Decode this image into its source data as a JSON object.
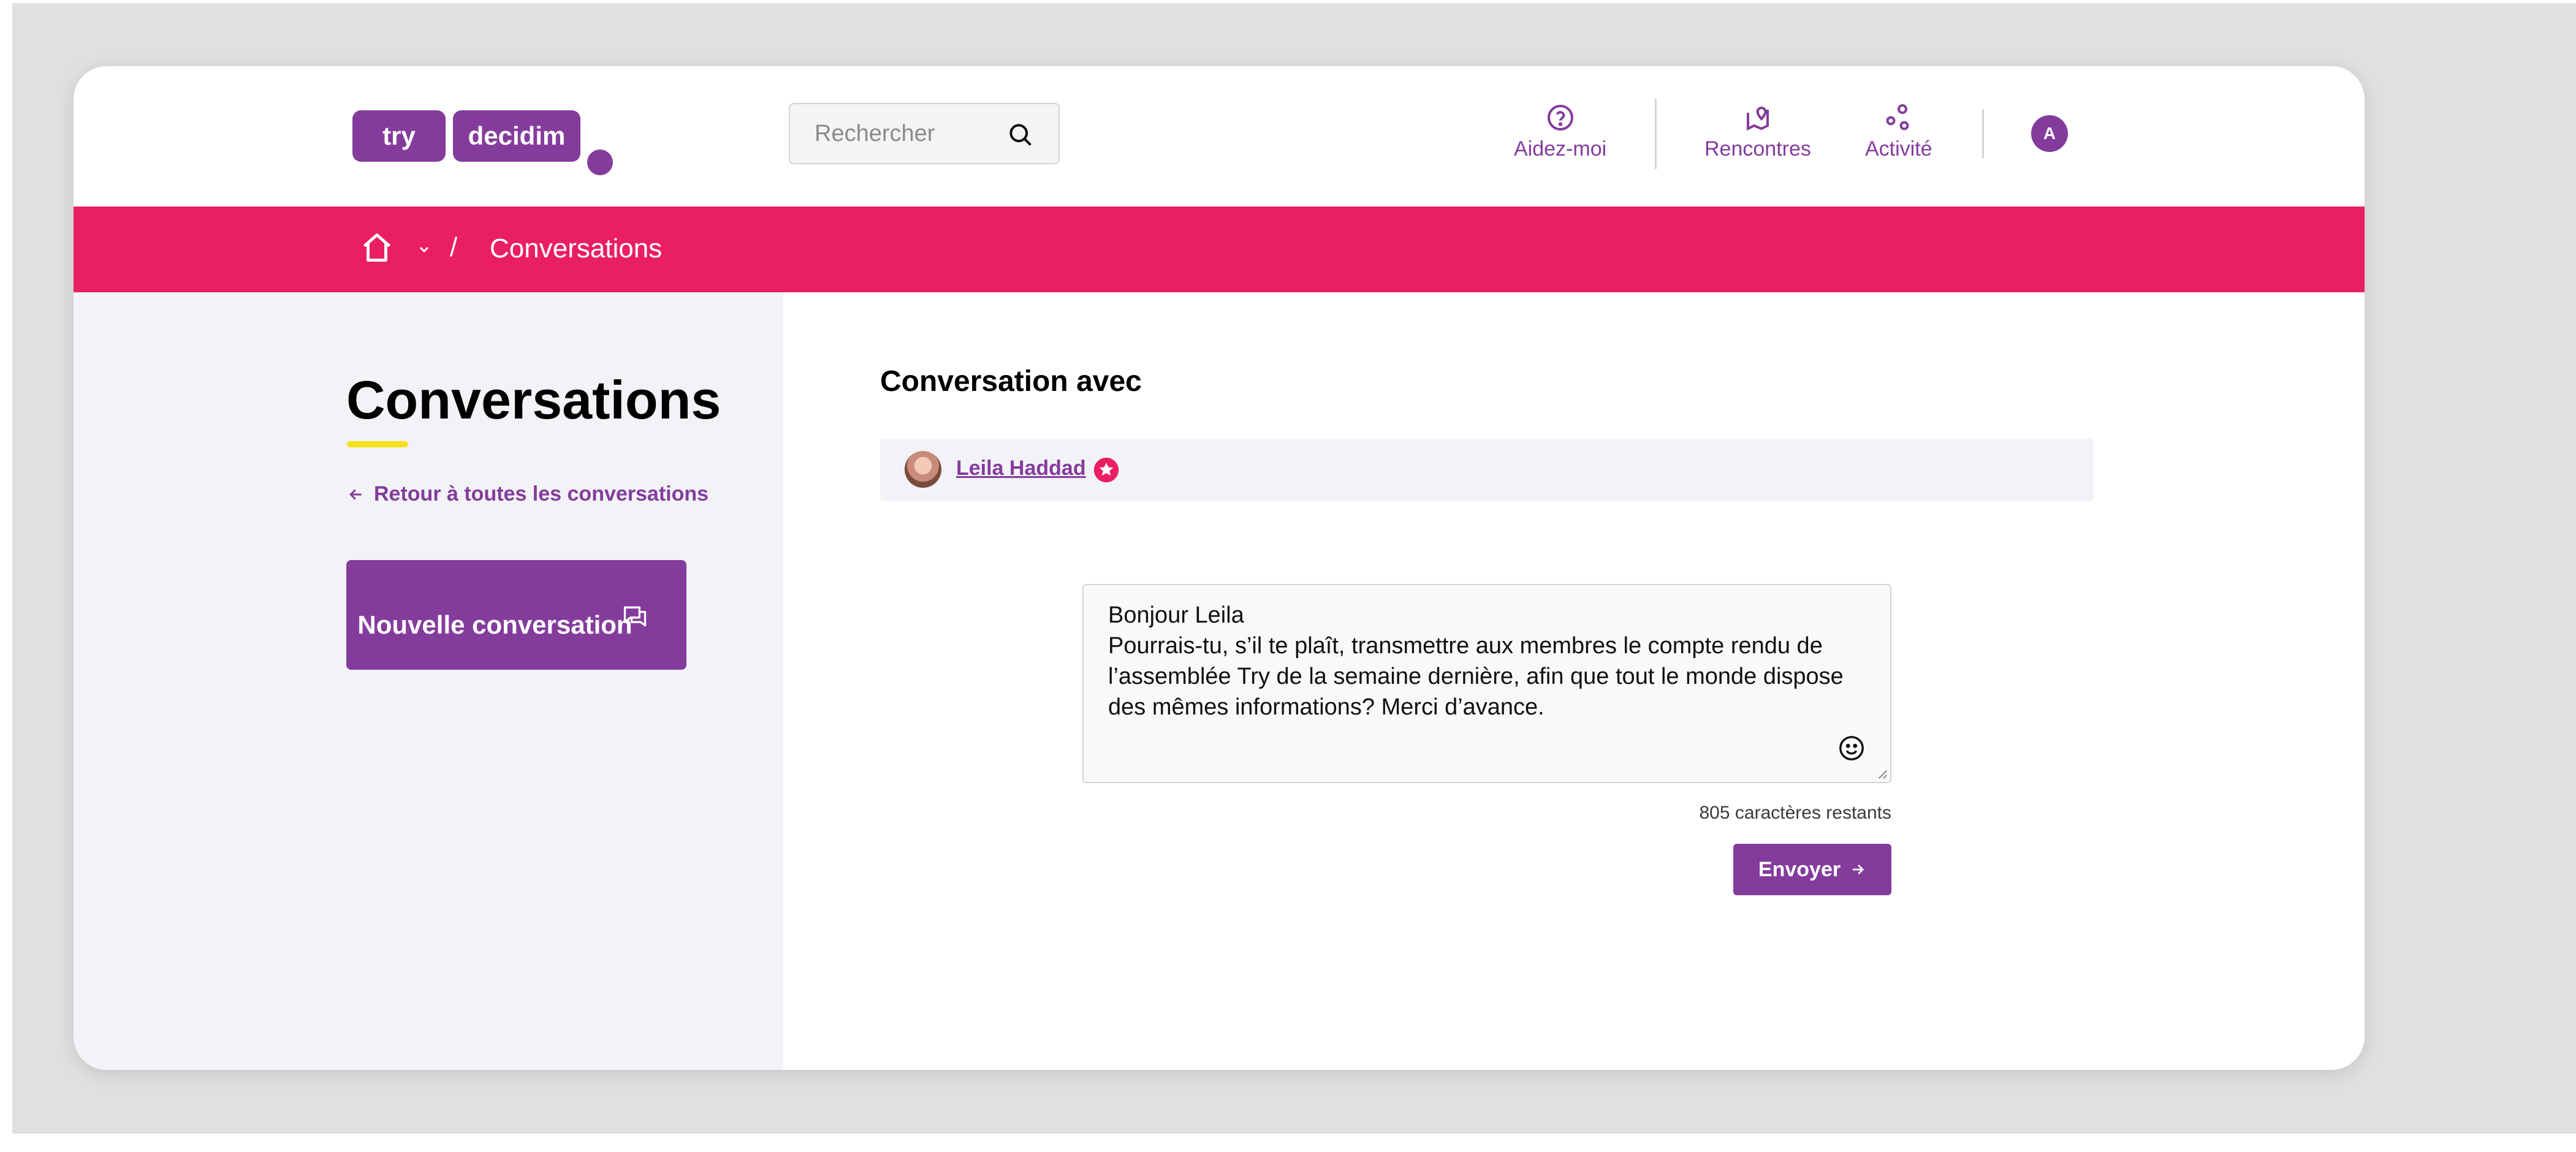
{
  "header": {
    "logo": {
      "part1": "try",
      "part2": "decidim"
    },
    "search": {
      "placeholder": "Rechercher"
    },
    "nav": [
      {
        "label": "Aidez-moi",
        "icon": "question-icon"
      },
      {
        "label": "Rencontres",
        "icon": "map-pin-icon"
      },
      {
        "label": "Activité",
        "icon": "activity-icon"
      }
    ],
    "user_initial": "A"
  },
  "breadcrumb": {
    "separator": "/",
    "current": "Conversations"
  },
  "sidebar": {
    "title": "Conversations",
    "back_link": "Retour à toutes les conversations",
    "new_button": "Nouvelle conversation"
  },
  "main": {
    "heading": "Conversation avec",
    "participant": {
      "name": "Leila Haddad"
    },
    "message": {
      "value": "Bonjour Leila\nPourrais-tu, s’il te plaît, transmettre aux membres le compte rendu de l’assemblée Try de la semaine dernière, afin que tout le monde dispose des mêmes informations? Merci d’avance."
    },
    "chars_remaining": "805 caractères restants",
    "send_button": "Envoyer"
  },
  "colors": {
    "brand_purple": "#843c9c",
    "breadcrumb_pink": "#e91e63",
    "accent_yellow": "#f7e11b"
  }
}
